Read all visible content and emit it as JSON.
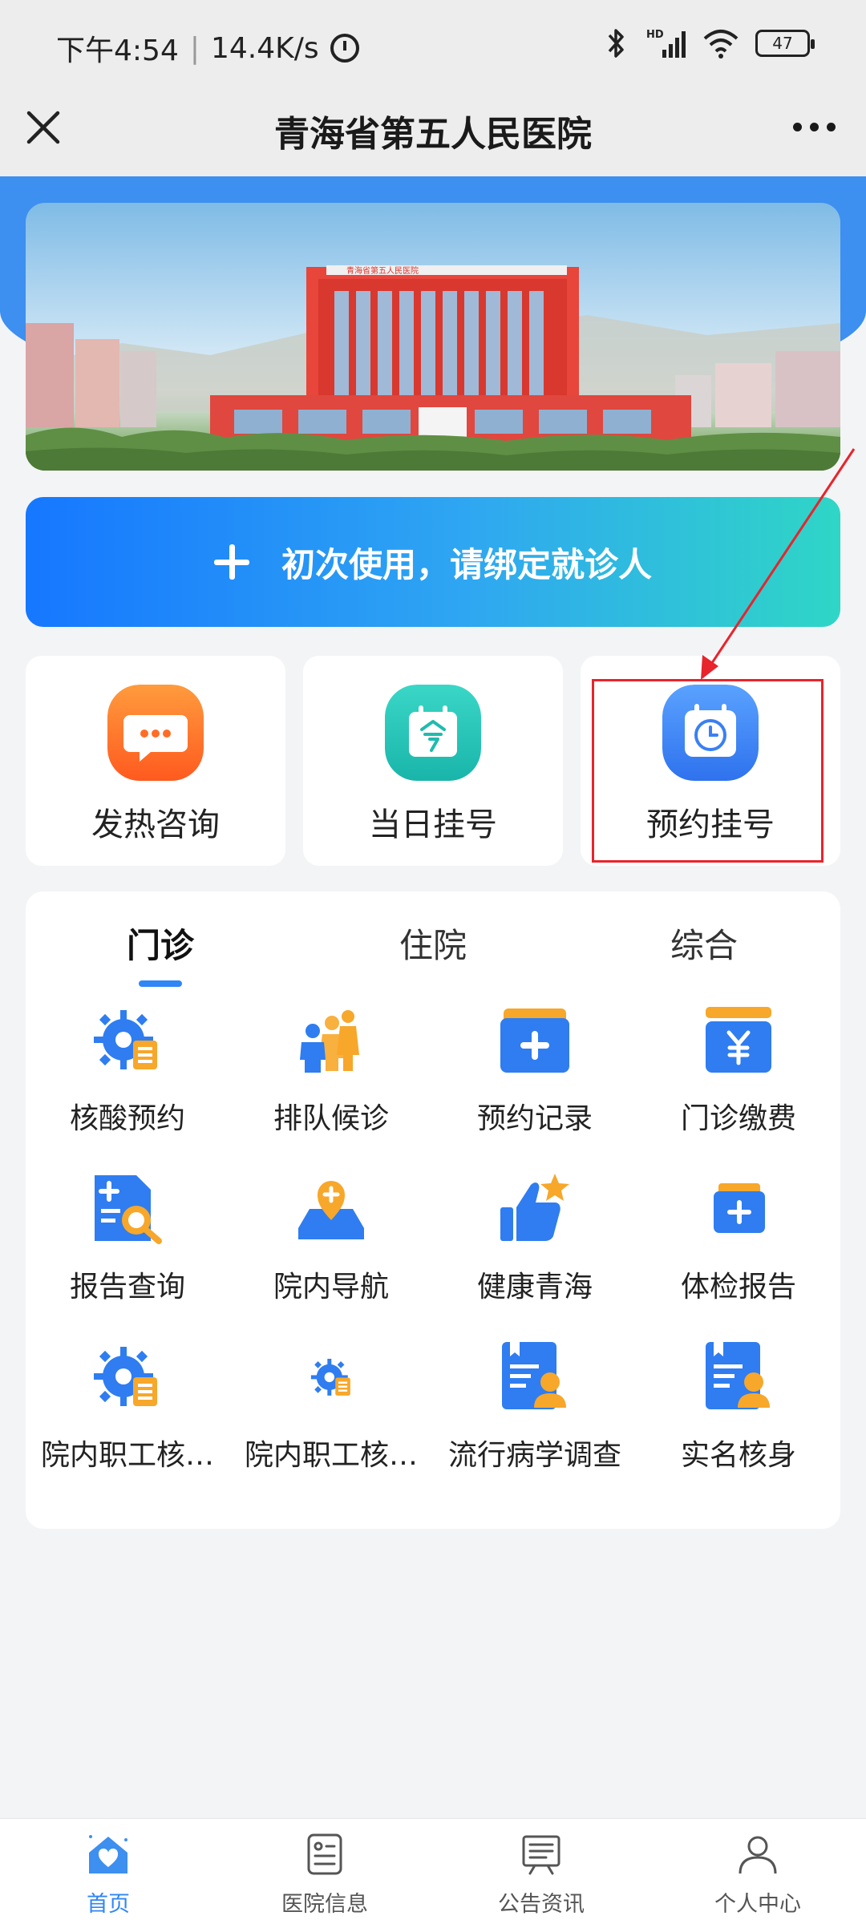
{
  "status_bar": {
    "time": "下午4:54",
    "speed": "14.4K/s",
    "signal_label": "HD",
    "battery": "47"
  },
  "title_bar": {
    "title": "青海省第五人民医院"
  },
  "banner": {
    "image": "hospital-building-photo",
    "sign_text": "青海省第五人民医院"
  },
  "bind_button": {
    "label": "初次使用，请绑定就诊人"
  },
  "quick_cards": [
    {
      "label": "发热咨询",
      "icon": "chat-bubble-icon",
      "color": "#ff7a2a"
    },
    {
      "label": "当日挂号",
      "icon": "calendar-today-icon",
      "color": "#25c5b9"
    },
    {
      "label": "预约挂号",
      "icon": "calendar-clock-icon",
      "color": "#3d85f5"
    }
  ],
  "tabs": [
    {
      "label": "门诊"
    },
    {
      "label": "住院"
    },
    {
      "label": "综合"
    }
  ],
  "services": [
    {
      "label": "核酸预约",
      "icon": "gear-document-icon"
    },
    {
      "label": "排队候诊",
      "icon": "people-queue-icon"
    },
    {
      "label": "预约记录",
      "icon": "medical-folder-icon"
    },
    {
      "label": "门诊缴费",
      "icon": "yuan-payment-icon"
    },
    {
      "label": "报告查询",
      "icon": "report-search-icon"
    },
    {
      "label": "院内导航",
      "icon": "map-pin-icon"
    },
    {
      "label": "健康青海",
      "icon": "thumbs-up-star-icon"
    },
    {
      "label": "体检报告",
      "icon": "medical-folder-icon"
    },
    {
      "label": "院内职工核…",
      "icon": "gear-document-icon"
    },
    {
      "label": "院内职工核…",
      "icon": "gear-document-icon"
    },
    {
      "label": "流行病学调查",
      "icon": "id-card-icon"
    },
    {
      "label": "实名核身",
      "icon": "id-card-icon"
    }
  ],
  "bottom_nav": [
    {
      "label": "首页",
      "icon": "home-heart-icon",
      "active": true
    },
    {
      "label": "医院信息",
      "icon": "info-card-icon",
      "active": false
    },
    {
      "label": "公告资讯",
      "icon": "notice-board-icon",
      "active": false
    },
    {
      "label": "个人中心",
      "icon": "person-icon",
      "active": false
    }
  ],
  "colors": {
    "accent": "#2f86f6",
    "highlight": "#e8242c"
  }
}
